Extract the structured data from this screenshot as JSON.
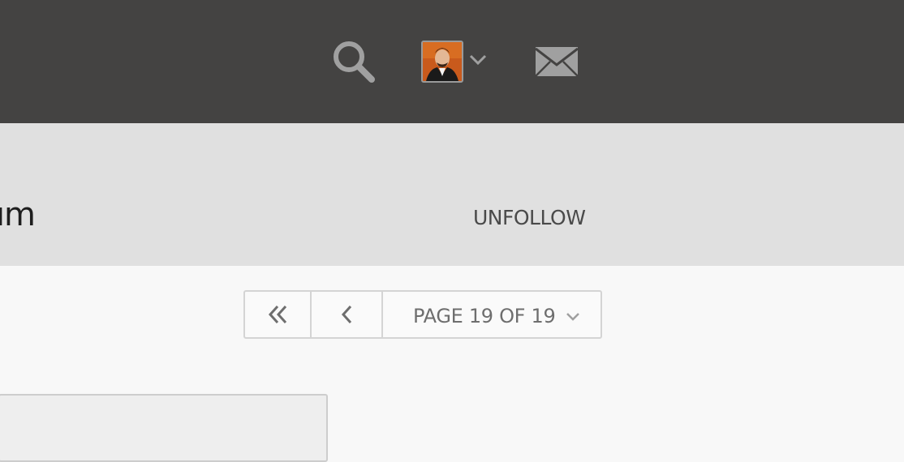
{
  "topbar": {
    "icons": {
      "search": "search-icon",
      "avatar_chevron": "chevron-down-icon",
      "mail": "mail-icon"
    },
    "colors": {
      "background": "#444342",
      "icon": "#a0a0a0"
    }
  },
  "subheader": {
    "title_fragment": "um",
    "unfollow_label": "UNFOLLOW",
    "background": "#e0e0e0"
  },
  "pagination": {
    "first_icon": "double-chevron-left-icon",
    "prev_icon": "chevron-left-icon",
    "page_label": "PAGE 19 OF 19",
    "select_icon": "chevron-down-icon",
    "current_page": 19,
    "total_pages": 19
  }
}
